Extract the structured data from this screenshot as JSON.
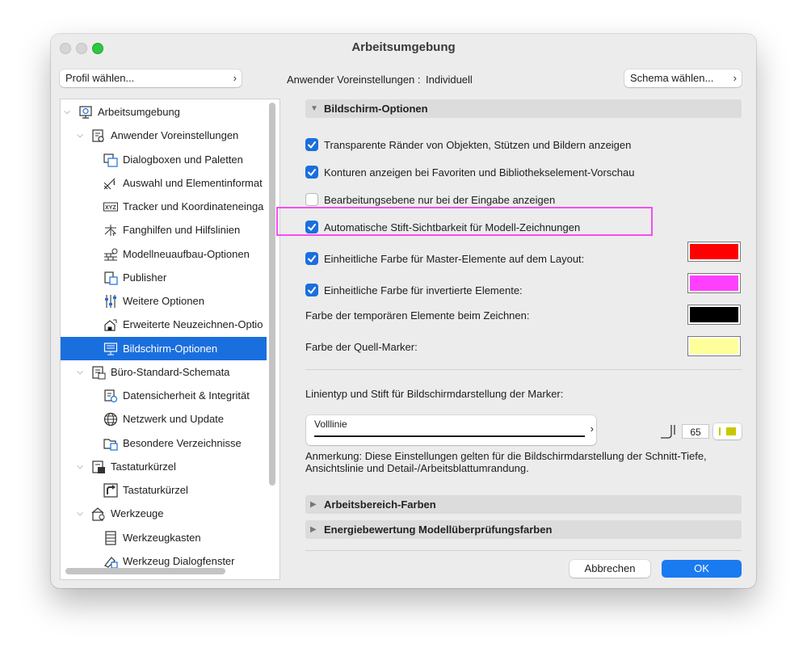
{
  "window": {
    "title": "Arbeitsumgebung"
  },
  "header": {
    "profile_button": "Profil wählen...",
    "settings_label": "Anwender Voreinstellungen :",
    "settings_value": "Individuell",
    "schema_button": "Schema wählen..."
  },
  "sidebar": {
    "items": [
      {
        "label": "Arbeitsumgebung",
        "level": 0,
        "disclosure": "expanded",
        "icon": "workspace-icon"
      },
      {
        "label": "Anwender Voreinstellungen",
        "level": 1,
        "disclosure": "expanded",
        "icon": "user-settings-icon"
      },
      {
        "label": "Dialogboxen und Paletten",
        "level": 2,
        "icon": "dialog-palette-icon"
      },
      {
        "label": "Auswahl und Elementinformat",
        "level": 2,
        "icon": "selection-info-icon"
      },
      {
        "label": "Tracker und Koordinateneinga",
        "level": 2,
        "icon": "xyz-tracker-icon"
      },
      {
        "label": "Fanghilfen und Hilfslinien",
        "level": 2,
        "icon": "snap-guides-icon"
      },
      {
        "label": "Modellneuaufbau-Optionen",
        "level": 2,
        "icon": "rebuild-bricks-icon"
      },
      {
        "label": "Publisher",
        "level": 2,
        "icon": "publisher-icon"
      },
      {
        "label": "Weitere Optionen",
        "level": 2,
        "icon": "sliders-icon"
      },
      {
        "label": "Erweiterte Neuzeichnen-Optio",
        "level": 2,
        "icon": "redraw-house-icon"
      },
      {
        "label": "Bildschirm-Optionen",
        "level": 2,
        "icon": "monitor-icon",
        "selected": true
      },
      {
        "label": "Büro-Standard-Schemata",
        "level": 1,
        "disclosure": "expanded",
        "icon": "office-standard-icon"
      },
      {
        "label": "Datensicherheit & Integrität",
        "level": 2,
        "icon": "data-safety-icon"
      },
      {
        "label": "Netzwerk und Update",
        "level": 2,
        "icon": "globe-icon"
      },
      {
        "label": "Besondere Verzeichnisse",
        "level": 2,
        "icon": "folder-icon"
      },
      {
        "label": "Tastaturkürzel",
        "level": 1,
        "disclosure": "expanded",
        "icon": "keyboard-shortcuts-icon"
      },
      {
        "label": "Tastaturkürzel",
        "level": 2,
        "icon": "shortcut-arrow-icon"
      },
      {
        "label": "Werkzeuge",
        "level": 1,
        "disclosure": "expanded",
        "icon": "tools-icon"
      },
      {
        "label": "Werkzeugkasten",
        "level": 2,
        "icon": "toolbox-icon"
      },
      {
        "label": "Werkzeug Dialogfenster",
        "level": 2,
        "icon": "tool-dialog-icon"
      }
    ]
  },
  "main": {
    "section_screen": "Bildschirm-Optionen",
    "options": [
      {
        "label": "Transparente Ränder von Objekten, Stützen und Bildern anzeigen",
        "checked": true
      },
      {
        "label": "Konturen anzeigen bei Favoriten und Bibliothekselement-Vorschau",
        "checked": true
      },
      {
        "label": "Bearbeitungsebene nur bei der Eingabe anzeigen",
        "checked": false
      },
      {
        "label": "Automatische Stift-Sichtbarkeit für Modell-Zeichnungen",
        "checked": true
      },
      {
        "label": "Einheitliche Farbe für Master-Elemente auf dem Layout:",
        "checked": true,
        "color": "#ff0000"
      },
      {
        "label": "Einheitliche Farbe für invertierte Elemente:",
        "checked": true,
        "color": "#ff3fff"
      }
    ],
    "colors": [
      {
        "label": "Farbe der temporären Elemente beim Zeichnen:",
        "color": "#000000"
      },
      {
        "label": "Farbe der Quell-Marker:",
        "color": "#ffff99"
      }
    ],
    "linetype_label": "Linientyp und Stift für Bildschirmdarstellung der Marker:",
    "linetype_value": "Volllinie",
    "pen_number": "65",
    "pen_color": "#c8c800",
    "note": "Anmerkung: Diese Einstellungen gelten für die Bildschirmdarstellung der Schnitt-Tiefe, Ansichtslinie und Detail-/Arbeitsblattumrandung.",
    "section_colors": "Arbeitsbereich-Farben",
    "section_energy": "Energiebewertung Modellüberprüfungsfarben",
    "highlight_color": "#f34ef3"
  },
  "footer": {
    "cancel": "Abbrechen",
    "ok": "OK"
  }
}
